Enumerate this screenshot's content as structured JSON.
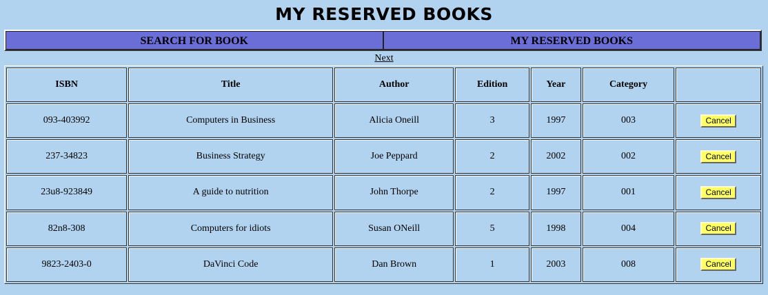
{
  "page": {
    "title": "MY RESERVED BOOKS"
  },
  "nav": {
    "search_label": "SEARCH FOR BOOK",
    "reserved_label": "MY RESERVED BOOKS"
  },
  "pagination": {
    "next_label": "Next"
  },
  "table": {
    "headers": {
      "isbn": "ISBN",
      "title": "Title",
      "author": "Author",
      "edition": "Edition",
      "year": "Year",
      "category": "Category"
    },
    "cancel_label": "Cancel",
    "rows": [
      {
        "isbn": "093-403992",
        "title": "Computers in Business",
        "author": "Alicia Oneill",
        "edition": "3",
        "year": "1997",
        "category": "003"
      },
      {
        "isbn": "237-34823",
        "title": "Business Strategy",
        "author": "Joe Peppard",
        "edition": "2",
        "year": "2002",
        "category": "002"
      },
      {
        "isbn": "23u8-923849",
        "title": "A guide to nutrition",
        "author": "John Thorpe",
        "edition": "2",
        "year": "1997",
        "category": "001"
      },
      {
        "isbn": "82n8-308",
        "title": "Computers for idiots",
        "author": "Susan ONeill",
        "edition": "5",
        "year": "1998",
        "category": "004"
      },
      {
        "isbn": "9823-2403-0",
        "title": "DaVinci Code",
        "author": "Dan Brown",
        "edition": "1",
        "year": "2003",
        "category": "008"
      }
    ]
  },
  "colors": {
    "background": "#b1d3ef",
    "nav_background": "#6c6ed8",
    "button_background": "#ffff66"
  }
}
